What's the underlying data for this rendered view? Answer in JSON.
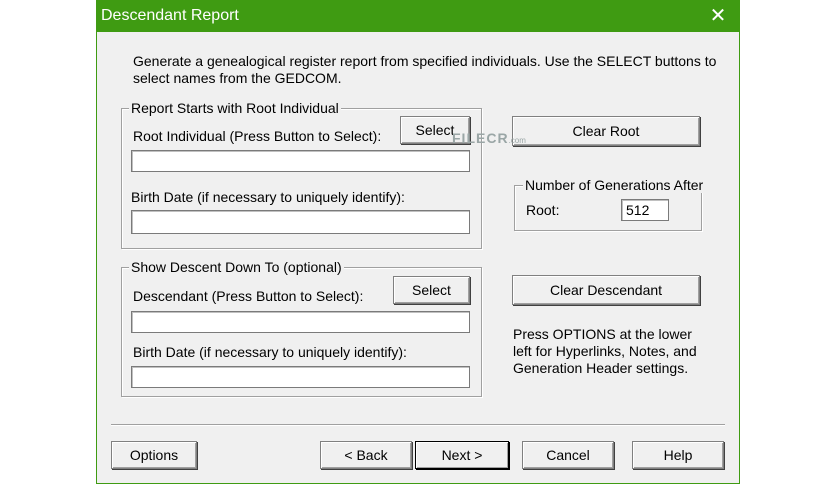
{
  "window": {
    "title": "Descendant Report",
    "close_glyph": "✕",
    "accent_color": "#3f9b12"
  },
  "intro": {
    "text": "Generate a genealogical register report from specified individuals. Use the SELECT buttons to select names from the GEDCOM."
  },
  "root_group": {
    "legend": "Report Starts with Root Individual",
    "root_label": "Root Individual (Press Button to Select):",
    "select_label": "Select",
    "root_value": "",
    "birth_label": "Birth Date (if necessary to uniquely identify):",
    "birth_value": ""
  },
  "descent_group": {
    "legend": "Show Descent Down To (optional)",
    "descendant_label": "Descendant (Press Button to Select):",
    "select_label": "Select",
    "descendant_value": "",
    "birth_label": "Birth Date (if necessary to uniquely identify):",
    "birth_value": ""
  },
  "right_panel": {
    "clear_root_label": "Clear Root",
    "generations_legend": "Number of Generations After",
    "generations_label": "Root:",
    "generations_value": "512",
    "clear_descendant_label": "Clear Descendant",
    "options_note": "Press OPTIONS at the lower left for Hyperlinks, Notes, and Generation Header settings."
  },
  "footer": {
    "options_label": "Options",
    "back_label": "< Back",
    "next_label": "Next >",
    "cancel_label": "Cancel",
    "help_label": "Help"
  },
  "watermark": {
    "brand": "FILECR",
    "suffix": ".com"
  }
}
